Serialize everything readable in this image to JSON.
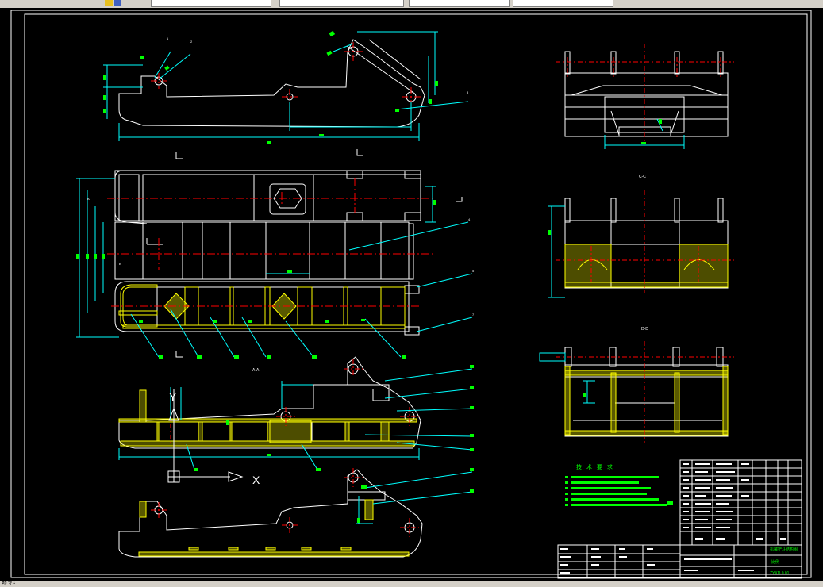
{
  "window": {
    "status_prompt": "命令:"
  },
  "drawing": {
    "view_labels": {
      "a": "A-A",
      "b": "B-B",
      "c": "C-C",
      "d": "D-D"
    },
    "axis": {
      "y": "Y",
      "x": "X"
    },
    "tech_req_title": "技 术 要 求",
    "title_block": {
      "name": "机械铲斗结构图",
      "scale": "比例",
      "drawing_no": "ZYXD.0.01"
    }
  },
  "colors": {
    "background": "#000000",
    "outline": "#ffffff",
    "center": "#ff0000",
    "dimension": "#00ffff",
    "text": "#00ff00",
    "hatch": "#ffff00"
  }
}
